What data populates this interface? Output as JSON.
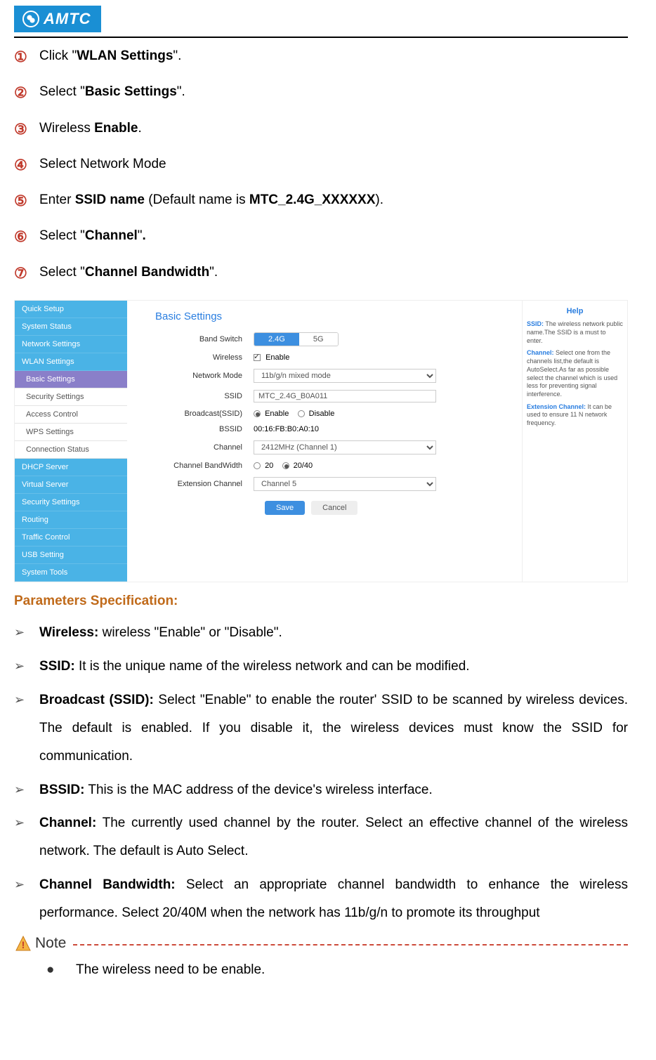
{
  "logo_text": "AMTC",
  "steps": [
    {
      "num": "①",
      "pre": "Click \"",
      "bold": "WLAN Settings",
      "post": "\"."
    },
    {
      "num": "②",
      "pre": "Select \"",
      "bold": "Basic Settings",
      "post": "\"."
    },
    {
      "num": "③",
      "pre": "Wireless ",
      "bold": "Enable",
      "post": "."
    },
    {
      "num": "④",
      "pre": "Select Network Mode",
      "bold": "",
      "post": ""
    },
    {
      "num": "⑤",
      "pre": "Enter ",
      "bold": "SSID name",
      "post": " (Default name is ",
      "bold2": "MTC_2.4G_XXXXXX",
      "post2": ")."
    },
    {
      "num": "⑥",
      "pre": "Select \"",
      "bold": "Channel",
      "post": "\"",
      "bold2": ".",
      "post2": ""
    },
    {
      "num": "⑦",
      "pre": "Select \"",
      "bold": "Channel Bandwidth",
      "post": "\"."
    }
  ],
  "screenshot": {
    "sidebar": {
      "items": [
        {
          "label": "Quick Setup",
          "type": "top"
        },
        {
          "label": "System Status",
          "type": "top"
        },
        {
          "label": "Network Settings",
          "type": "top"
        },
        {
          "label": "WLAN Settings",
          "type": "top"
        },
        {
          "label": "Basic Settings",
          "type": "sub",
          "active": true
        },
        {
          "label": "Security Settings",
          "type": "sub"
        },
        {
          "label": "Access Control",
          "type": "sub"
        },
        {
          "label": "WPS Settings",
          "type": "sub"
        },
        {
          "label": "Connection Status",
          "type": "sub"
        },
        {
          "label": "DHCP Server",
          "type": "top"
        },
        {
          "label": "Virtual Server",
          "type": "top"
        },
        {
          "label": "Security Settings",
          "type": "top"
        },
        {
          "label": "Routing",
          "type": "top"
        },
        {
          "label": "Traffic Control",
          "type": "top"
        },
        {
          "label": "USB Setting",
          "type": "top"
        },
        {
          "label": "System Tools",
          "type": "top"
        }
      ]
    },
    "panel": {
      "title": "Basic Settings",
      "rows": {
        "band_switch": {
          "label": "Band Switch",
          "opt1": "2.4G",
          "opt2": "5G"
        },
        "wireless": {
          "label": "Wireless",
          "value": "Enable"
        },
        "network_mode": {
          "label": "Network Mode",
          "value": "11b/g/n mixed mode"
        },
        "ssid": {
          "label": "SSID",
          "value": "MTC_2.4G_B0A011"
        },
        "broadcast": {
          "label": "Broadcast(SSID)",
          "opt1": "Enable",
          "opt2": "Disable"
        },
        "bssid": {
          "label": "BSSID",
          "value": "00:16:FB:B0:A0:10"
        },
        "channel": {
          "label": "Channel",
          "value": "2412MHz (Channel 1)"
        },
        "bandwidth": {
          "label": "Channel BandWidth",
          "opt1": "20",
          "opt2": "20/40"
        },
        "ext_channel": {
          "label": "Extension Channel",
          "value": "Channel 5"
        }
      },
      "save": "Save",
      "cancel": "Cancel"
    },
    "help": {
      "title": "Help",
      "p1_b": "SSID:",
      "p1": " The wireless network public name.The SSID is a must to enter.",
      "p2_b": "Channel:",
      "p2": " Select one from the channels list,the default is AutoSelect.As far as possible select the channel which is used less for preventing signal interference.",
      "p3_b": "Extension Channel:",
      "p3": " It can be used to ensure 11 N network frequency."
    }
  },
  "params_title": "Parameters Specification:",
  "params": [
    {
      "bold": "Wireless:",
      "text": " wireless \"Enable\" or \"Disable\"."
    },
    {
      "bold": "SSID:",
      "text": " It is the unique name of the wireless network and can be modified."
    },
    {
      "bold": "Broadcast (SSID):",
      "text": " Select \"Enable\" to enable the router' SSID to be scanned by wireless devices. The default is enabled. If you disable it, the wireless devices must know the SSID for communication."
    },
    {
      "bold": "BSSID:",
      "text": " This is the MAC address of the device's wireless interface."
    },
    {
      "bold": "Channel:",
      "text": " The currently used channel by the router. Select an effective channel of the wireless network. The default is Auto Select."
    },
    {
      "bold": "Channel Bandwidth:",
      "text": " Select an appropriate channel bandwidth to enhance the wireless performance. Select 20/40M when the network has 11b/g/n to promote its throughput"
    }
  ],
  "note_label": "Note",
  "note_items": [
    "The wireless need to be enable."
  ]
}
